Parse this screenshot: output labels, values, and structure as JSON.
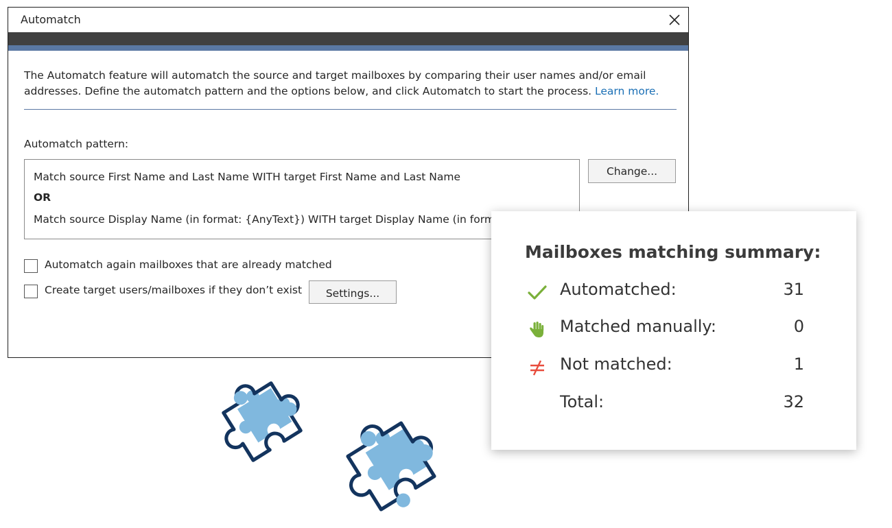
{
  "dialog": {
    "title": "Automatch",
    "intro": "The Automatch feature will automatch the source and target mailboxes by comparing their user names and/or email addresses. Define the automatch pattern and the options below, and click Automatch to start the process.",
    "learn_more": "Learn more.",
    "pattern_label": "Automatch pattern:",
    "pattern_lines": [
      "Match source First Name and Last Name WITH target First Name and Last Name",
      "OR",
      "Match source Display Name (in format: {AnyText}) WITH target Display Name (in format: {AnyText})"
    ],
    "change_button": "Change...",
    "checkboxes": [
      {
        "label": "Automatch again mailboxes that are already matched",
        "checked": false
      },
      {
        "label": "Create target users/mailboxes if they don’t exist",
        "checked": false
      }
    ],
    "settings_button": "Settings..."
  },
  "summary": {
    "title": "Mailboxes matching summary:",
    "rows": [
      {
        "icon": "check-icon",
        "label": "Automatched:",
        "value": "31",
        "color": "#7ab03a"
      },
      {
        "icon": "hand-icon",
        "label": "Matched manually:",
        "value": "0",
        "color": "#7ab03a"
      },
      {
        "icon": "not-equal-icon",
        "label": "Not matched:",
        "value": "1",
        "color": "#e84c3d"
      },
      {
        "icon": "",
        "label": "Total:",
        "value": "32",
        "color": ""
      }
    ]
  },
  "colors": {
    "title_band": "#404040",
    "accent_band": "#5a78a3",
    "link": "#1a6fb5",
    "puzzle_fill": "#80b8de",
    "puzzle_outline": "#13345e"
  }
}
